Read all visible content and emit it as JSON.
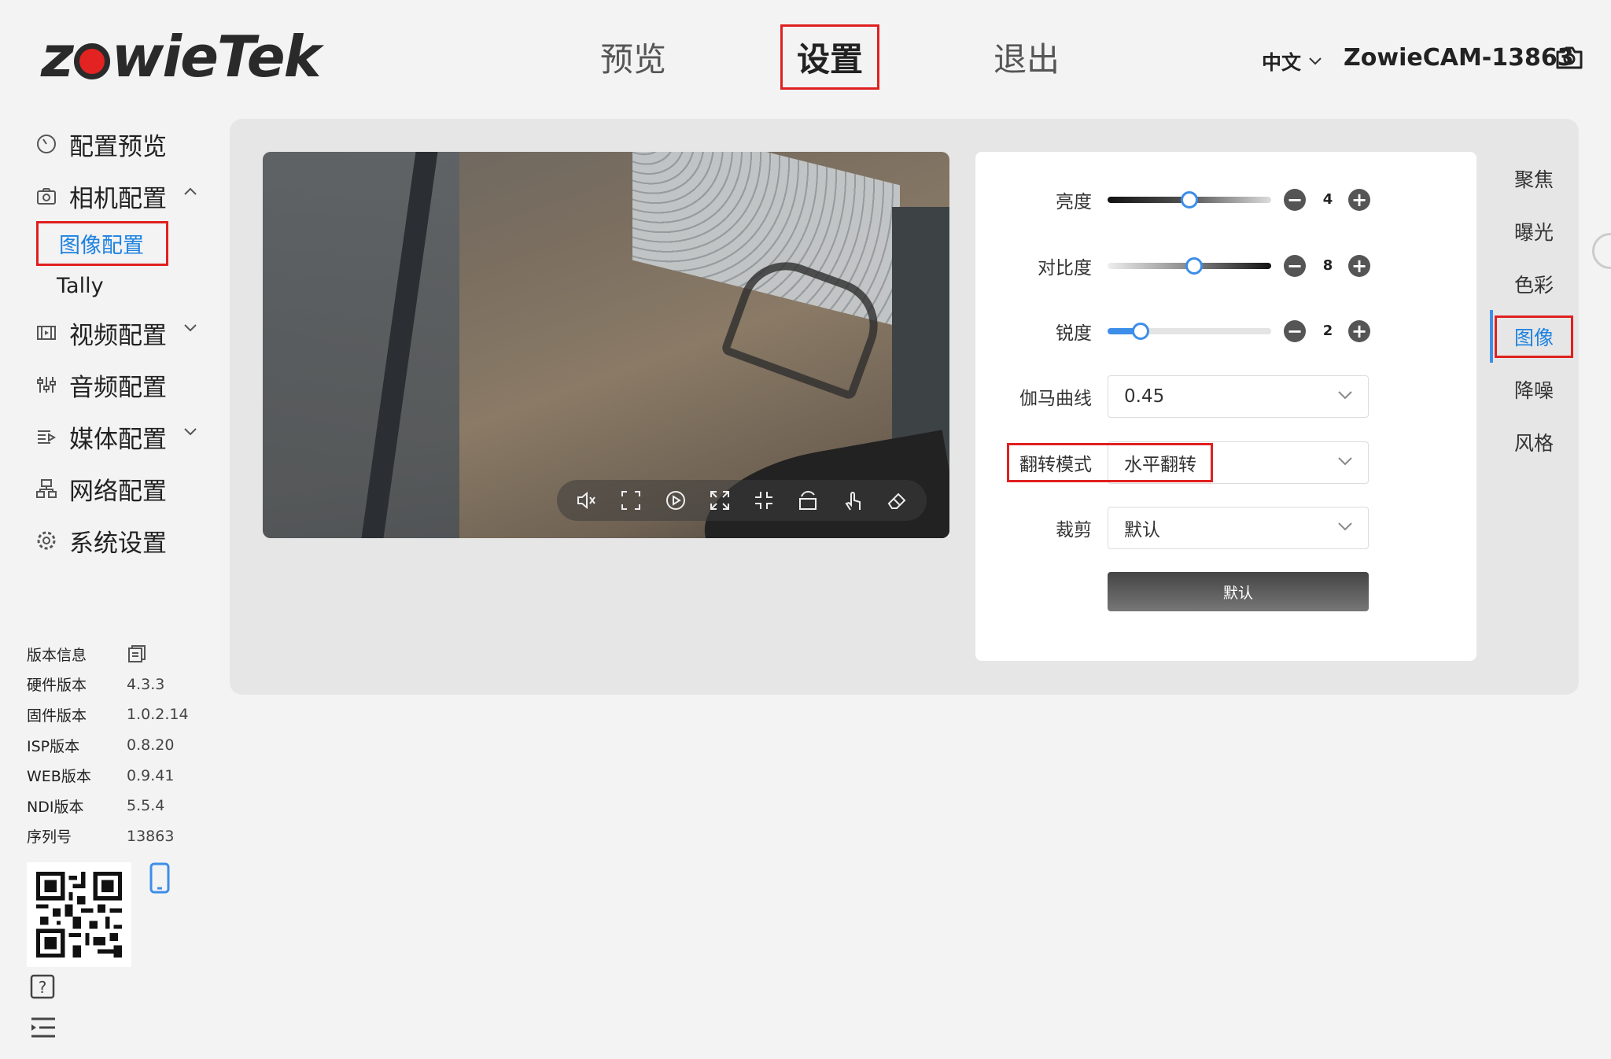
{
  "logo": {
    "text_left": "z",
    "text_right": "wieTek"
  },
  "nav": {
    "preview": "预览",
    "settings": "设置",
    "logout": "退出"
  },
  "header": {
    "language": "中文",
    "device_name": "ZowieCAM-13863"
  },
  "sidebar": {
    "items": [
      {
        "label": "配置预览"
      },
      {
        "label": "相机配置"
      },
      {
        "label": "视频配置"
      },
      {
        "label": "音频配置"
      },
      {
        "label": "媒体配置"
      },
      {
        "label": "网络配置"
      },
      {
        "label": "系统设置"
      }
    ],
    "sub_items": [
      {
        "label": "图像配置"
      },
      {
        "label": "Tally"
      }
    ]
  },
  "version": {
    "title": "版本信息",
    "rows": [
      {
        "key": "硬件版本",
        "value": "4.3.3"
      },
      {
        "key": "固件版本",
        "value": "1.0.2.14"
      },
      {
        "key": "ISP版本",
        "value": "0.8.20"
      },
      {
        "key": "WEB版本",
        "value": "0.9.41"
      },
      {
        "key": "NDI版本",
        "value": "5.5.4"
      },
      {
        "key": "序列号",
        "value": "13863"
      }
    ]
  },
  "image_settings": {
    "brightness": {
      "label": "亮度",
      "value": "4",
      "level": 0.5
    },
    "contrast": {
      "label": "对比度",
      "value": "8",
      "level": 0.53
    },
    "sharpness": {
      "label": "锐度",
      "value": "2",
      "level": 0.2
    },
    "gamma": {
      "label": "伽马曲线",
      "value": "0.45"
    },
    "flip": {
      "label": "翻转模式",
      "value": "水平翻转"
    },
    "crop": {
      "label": "裁剪",
      "value": "默认"
    },
    "default_button": "默认"
  },
  "right_tabs": [
    "聚焦",
    "曝光",
    "色彩",
    "图像",
    "降噪",
    "风格"
  ],
  "colors": {
    "accent": "#1e82e0",
    "highlight": "#e02020"
  }
}
